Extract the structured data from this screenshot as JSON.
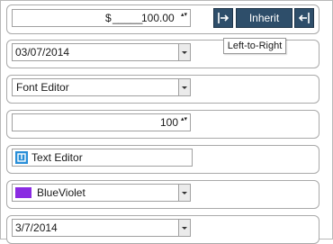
{
  "currency": {
    "symbol": "$",
    "blank": "_____",
    "amount": "100.00",
    "spin_glyph": "▴▾"
  },
  "direction_buttons": {
    "ltr_icon": "arrow-right-to-bar-icon",
    "inherit_label": "Inherit",
    "rtl_icon": "arrow-left-to-bar-icon"
  },
  "tooltip": {
    "text": "Left-to-Right"
  },
  "date_picker": {
    "value": "03/07/2014"
  },
  "font_editor": {
    "value": "Font Editor"
  },
  "numeric": {
    "value": "100",
    "spin_glyph": "▴▾"
  },
  "text_editor": {
    "value": "Text Editor",
    "icon": "text-editor-icon",
    "icon_color": "#2a8fd8"
  },
  "color_picker": {
    "value": "BlueViolet",
    "swatch_color": "#8a2be2"
  },
  "short_date": {
    "value": "3/7/2014"
  }
}
